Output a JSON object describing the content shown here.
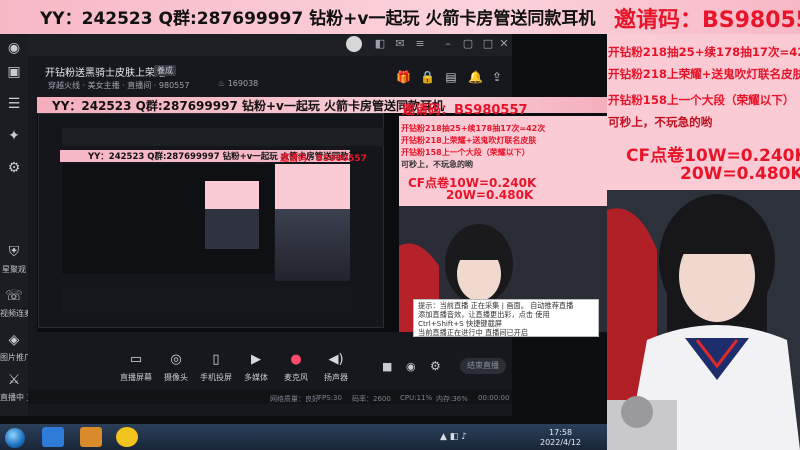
{
  "banner": {
    "left_text": "YY：242523   Q群:287699997   钻粉+v一起玩   火箭卡房管送同款耳机",
    "right_text": "邀请码：BS980557"
  },
  "promo": {
    "lines": [
      "开钻粉218抽25+续178抽17次=42次",
      "开钻粉218上荣耀+送鬼吹灯联名皮肤",
      "开钻粉158上一个大段（荣耀以下）",
      "可秒上，不玩急的哟"
    ],
    "price_10w": "CF点卷10W=0.240K",
    "price_20w": "20W=0.480K"
  },
  "window": {
    "room_title": "开钻粉送黑骑士皮肤上荣耀",
    "room_badge": "養成",
    "room_tags": "穿越火线 · 美女主播 · 直播间 · 980557",
    "viewer_count": "169038"
  },
  "mirror": {
    "left_text": "YY：242523   Q群:287699997   钻粉+v一起玩   火箭卡房管送同款耳机",
    "code": "邀请码：BS980557",
    "lines": [
      "开钻粉218抽25+续178抽17次=42次",
      "开钻粉218上荣耀+送鬼吹灯联名皮肤",
      "开钻粉158上一个大段（荣耀以下）",
      "可秒上，不玩急的哟"
    ],
    "price_10w": "CF点卷10W=0.240K",
    "price_20w": "20W=0.480K"
  },
  "nested": {
    "left_text": "YY：242523   Q群:287699997   钻粉+v一起玩   火箭卡房管送同款耳机",
    "code": "邀请码：BS980557"
  },
  "notice": {
    "lines": [
      "提示：当前直播   正在采集 | 画面。 自动推荐直播",
      "添加直播音效，让直播更出彩，点击   使用",
      "Ctrl+Shift+S 快捷键截屏",
      "当前直播正在进行中    直播间已开启"
    ]
  },
  "sidebar": {
    "items": [
      {
        "label": "直播",
        "icon": "live-icon"
      },
      {
        "label": "素材库",
        "icon": "library-icon"
      },
      {
        "label": "互动",
        "icon": "interact-icon"
      },
      {
        "label": "设置",
        "icon": "settings-icon"
      },
      {
        "label": "星聚观",
        "icon": "shield-icon"
      },
      {
        "label": "视频连麦",
        "icon": "video-link-icon"
      },
      {
        "label": "图片推广",
        "icon": "image-icon"
      },
      {
        "label": "PK",
        "icon": "pk-icon"
      }
    ]
  },
  "toolbar": {
    "items": [
      {
        "label": "直播屏幕",
        "icon": "screen-icon"
      },
      {
        "label": "摄像头",
        "icon": "camera-icon"
      },
      {
        "label": "手机投屏",
        "icon": "phone-cast-icon"
      },
      {
        "label": "多媒体",
        "icon": "media-icon"
      },
      {
        "label": "麦克风",
        "icon": "mic-icon"
      },
      {
        "label": "扬声器",
        "icon": "speaker-icon"
      }
    ],
    "start_label": "结束直播"
  },
  "status": {
    "left": "直播中  直播时间",
    "items": [
      "网络质量：良好",
      "FPS:30",
      "码率：2600",
      "CPU:11%",
      "内存:36%",
      "00:00:00"
    ]
  },
  "taskbar": {
    "time": "17:58",
    "date": "2022/4/12"
  },
  "colors": {
    "accent_red": "#e8142a",
    "banner_pink": "#fbd3dc",
    "panel_pink": "#fbcbd5",
    "app_dark": "#17181d"
  }
}
